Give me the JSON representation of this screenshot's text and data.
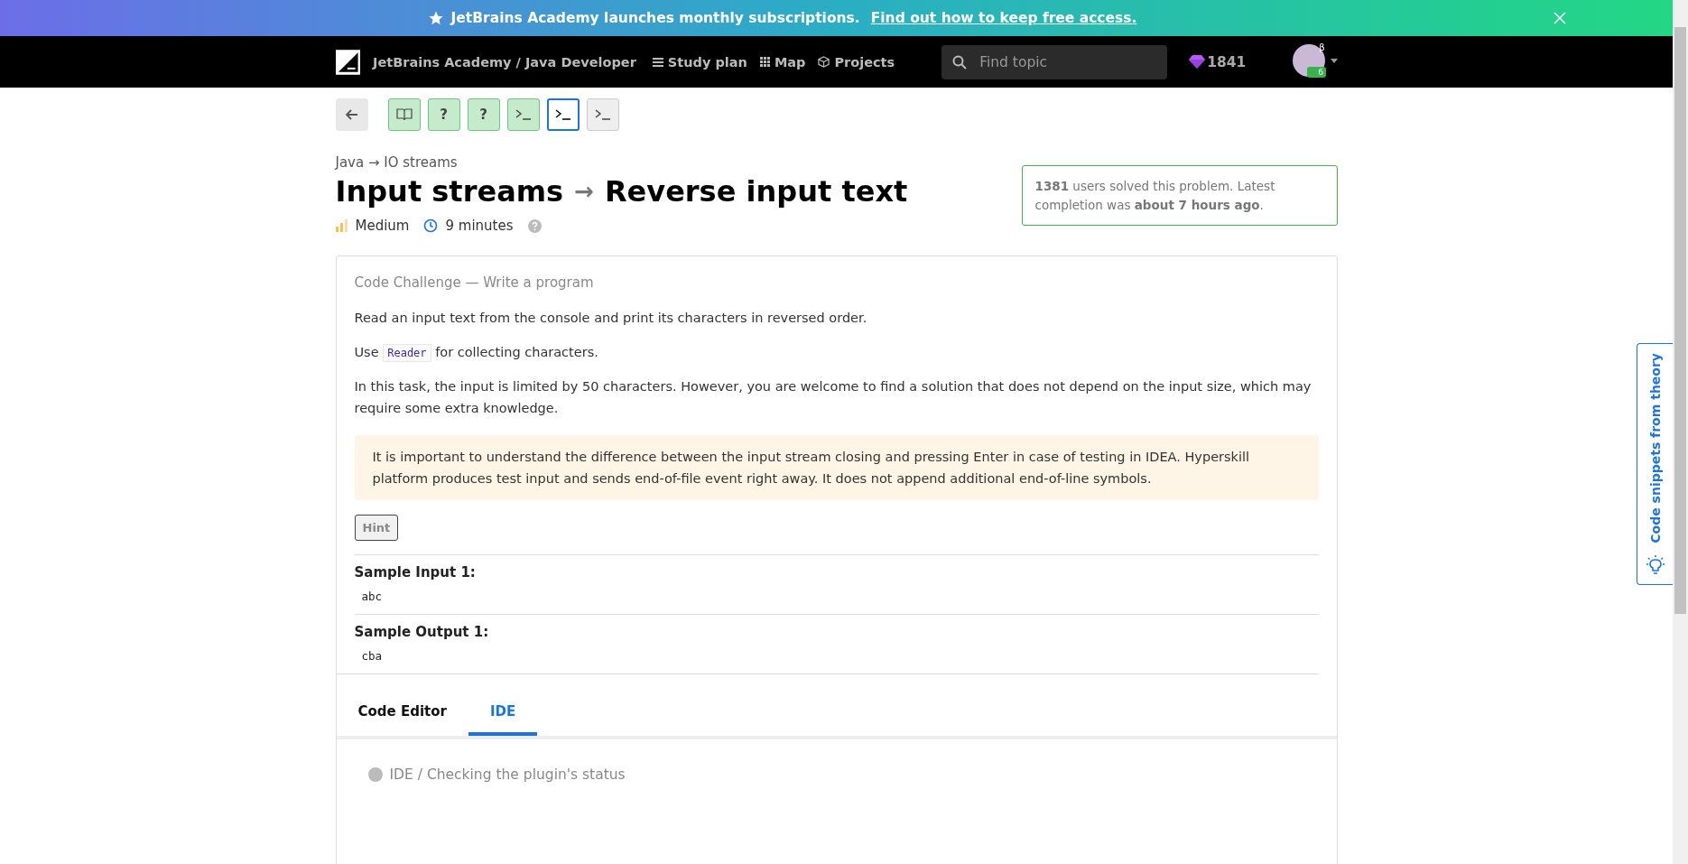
{
  "banner": {
    "text": "JetBrains Academy launches monthly subscriptions.",
    "link": "Find out how to keep free access."
  },
  "nav": {
    "brand": "JetBrains Academy / Java Developer",
    "items": [
      {
        "kind": "list",
        "label": "Study plan"
      },
      {
        "kind": "grid",
        "label": "Map"
      },
      {
        "kind": "cube",
        "label": "Projects"
      }
    ],
    "search": {
      "placeholder": "Find topic"
    },
    "gems": "1841",
    "avatar_beta": "β",
    "avatar_badge": "6"
  },
  "steps": [
    {
      "kind": "theory",
      "solved": true,
      "selected": false
    },
    {
      "kind": "quiz",
      "label": "?",
      "solved": true,
      "selected": false
    },
    {
      "kind": "quiz",
      "label": "?",
      "solved": true,
      "selected": false
    },
    {
      "kind": "code",
      "solved": true,
      "selected": false
    },
    {
      "kind": "code",
      "solved": false,
      "selected": true
    },
    {
      "kind": "code",
      "solved": false,
      "selected": false
    }
  ],
  "breadcrumb": "Java → IO streams",
  "title": {
    "topic": "Input streams",
    "arrow": "→",
    "name": "Reverse input text"
  },
  "meta": {
    "difficulty": "Medium",
    "time": "9 minutes"
  },
  "solved_box": "**1381** users solved this problem. Latest completion was **about 7 hours ago**.",
  "card": {
    "type": "Code Challenge — Write a program",
    "paragraphs": [
      {
        "parts": [
          {
            "kind": "text",
            "text": "Read an input text from the console and print its characters in reversed order."
          }
        ]
      },
      {
        "parts": [
          {
            "kind": "text",
            "text": "Use "
          },
          {
            "kind": "code",
            "text": "Reader"
          },
          {
            "kind": "text",
            "text": " for collecting characters."
          }
        ]
      },
      {
        "parts": [
          {
            "kind": "text",
            "text": "In this task, the input is limited by 50 characters. However, you are welcome to find a solution that does not depend on the input size, which may require some extra knowledge."
          }
        ]
      }
    ],
    "note": "It is important to understand the difference between the input stream closing and pressing Enter in case of testing in IDEA. Hyperskill platform produces test input and sends end-of-file event right away. It does not append additional end-of-line symbols.",
    "hint": "Hint",
    "samples": [
      {
        "title": "Sample Input 1:",
        "value": "abc"
      },
      {
        "title": "Sample Output 1:",
        "value": "cba"
      }
    ],
    "tabs": [
      {
        "label": "Code Editor",
        "selected": false
      },
      {
        "label": "IDE",
        "selected": true
      }
    ],
    "ide_status": "IDE / Checking the plugin's status"
  },
  "side_tab": "Code snippets from theory"
}
